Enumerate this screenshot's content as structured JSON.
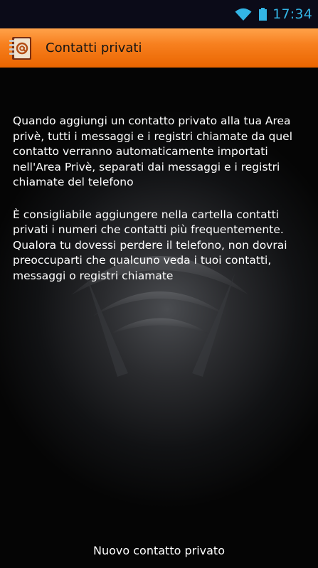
{
  "status_bar": {
    "time": "17:34",
    "icons": [
      "wifi-icon",
      "battery-icon"
    ],
    "clock_color": "#33b5e5"
  },
  "action_bar": {
    "icon": "contacts-book-icon",
    "title": "Contatti privati",
    "color": "#f7801f"
  },
  "content": {
    "paragraphs": [
      "Quando aggiungi un contatto privato alla tua Area privè, tutti i messaggi e i registri chiamate da quel contatto verranno automaticamente importati nell'Area Privè, separati dai messaggi e i registri chiamate del telefono",
      "È consigliabile aggiungere nella cartella contatti privati i numeri che contatti più frequentemente. Qualora tu dovessi perdere il telefono, non dovrai preoccuparti che qualcuno veda i tuoi contatti, messaggi o registri chiamate"
    ]
  },
  "footer": {
    "button_label": "Nuovo contatto privato"
  }
}
